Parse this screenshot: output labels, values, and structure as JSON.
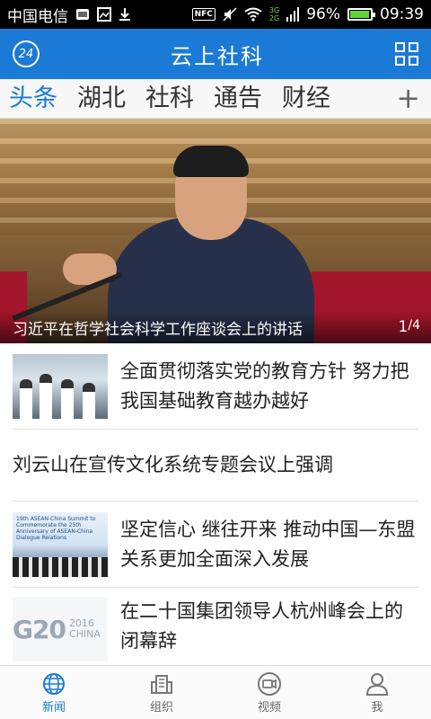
{
  "status_bar": {
    "carrier": "中国电信",
    "network_type_top": "3G",
    "network_type_bottom": "2G",
    "nfc_label": "NFC",
    "battery_percent": "96%",
    "battery_level": 0.96,
    "time": "09:39"
  },
  "header": {
    "weather_badge": "24",
    "title": "云上社科"
  },
  "tabs": [
    {
      "label": "头条",
      "active": true
    },
    {
      "label": "湖北",
      "active": false
    },
    {
      "label": "社科",
      "active": false
    },
    {
      "label": "通告",
      "active": false
    },
    {
      "label": "财经",
      "active": false
    }
  ],
  "tab_add_label": "+",
  "hero": {
    "caption": "习近平在哲学社会科学工作座谈会上的讲话",
    "current": "1",
    "separator": "/",
    "total": "4"
  },
  "news": [
    {
      "title": "全面贯彻落实党的教育方针 努力把我国基础教育越办越好"
    },
    {
      "title": "刘云山在宣传文化系统专题会议上强调"
    },
    {
      "title": "坚定信心 继往开来 推动中国—东盟关系更加全面深入发展",
      "thumb_text": "19th ASEAN-China Summit to Commemorate the 25th Anniversary of ASEAN-China Dialogue Relations"
    },
    {
      "title": "在二十国集团领导人杭州峰会上的闭幕辞",
      "thumb_logo": "G20",
      "thumb_sub": "2016 CHINA"
    }
  ],
  "bottom_nav": [
    {
      "label": "新闻",
      "active": true
    },
    {
      "label": "组织",
      "active": false
    },
    {
      "label": "视频",
      "active": false
    },
    {
      "label": "我",
      "active": false
    }
  ],
  "colors": {
    "primary": "#1a7ad6",
    "status_bg": "#000000",
    "battery": "#5fd23e"
  }
}
